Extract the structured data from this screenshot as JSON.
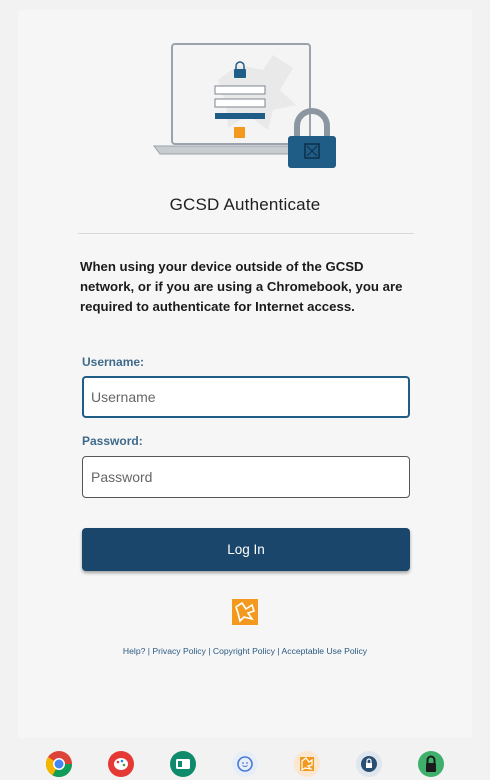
{
  "header": {
    "title": "GCSD Authenticate"
  },
  "notice": "When using your device outside of the GCSD network, or if you are using a Chromebook, you are required to authenticate for Internet access.",
  "form": {
    "username_label": "Username:",
    "username_placeholder": "Username",
    "username_value": "",
    "password_label": "Password:",
    "password_placeholder": "Password",
    "password_value": "",
    "login_label": "Log In"
  },
  "footer": {
    "links": [
      "Help?",
      "Privacy Policy",
      "Copyright Policy",
      "Acceptable Use Policy"
    ],
    "separator": " | "
  },
  "shelf": {
    "apps": [
      {
        "name": "chrome-icon"
      },
      {
        "name": "paint-icon"
      },
      {
        "name": "classroom-icon"
      },
      {
        "name": "chat-icon"
      },
      {
        "name": "gcsd-app-icon"
      },
      {
        "name": "security-icon"
      },
      {
        "name": "lock-app-icon"
      }
    ]
  },
  "colors": {
    "primary": "#19466a",
    "label": "#3f6a8a",
    "link": "#2a5a82",
    "brand_orange": "#f39a1e"
  }
}
